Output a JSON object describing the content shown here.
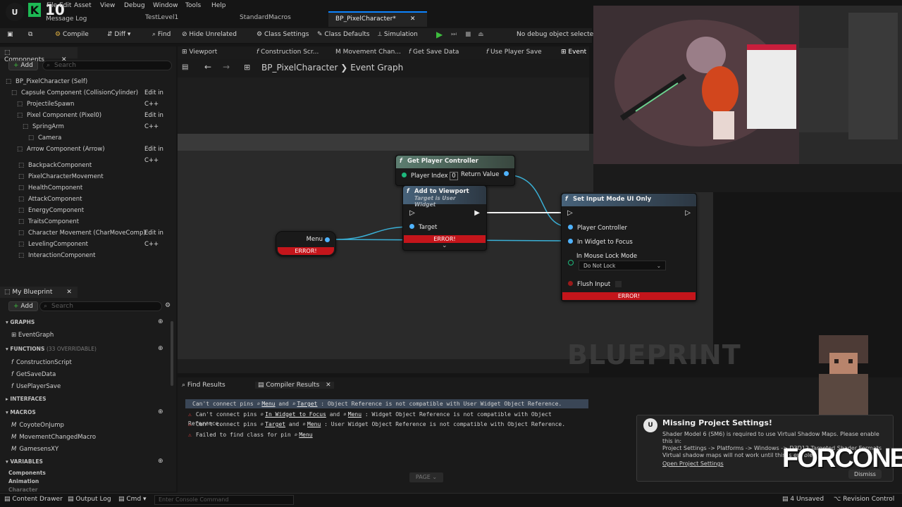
{
  "app": {
    "version_badge": "K",
    "version_num": "10",
    "message_log": "Message Log"
  },
  "menu": [
    "File",
    "Edit",
    "Asset",
    "View",
    "Debug",
    "Window",
    "Tools",
    "Help"
  ],
  "document_tabs": [
    {
      "label": "TestLevel1",
      "active": false
    },
    {
      "label": "StandardMacros",
      "active": false
    },
    {
      "label": "BP_PixelCharacter*",
      "active": true
    }
  ],
  "toolbar": {
    "compile": "Compile",
    "diff": "Diff",
    "find": "Find",
    "hide_unrelated": "Hide Unrelated",
    "class_settings": "Class Settings",
    "class_defaults": "Class Defaults",
    "simulation": "Simulation",
    "debug_object": "No debug object selected"
  },
  "components_panel": {
    "title": "Components",
    "add": "Add",
    "search_placeholder": "Search",
    "edit_in_cpp": "Edit in C++",
    "items": [
      {
        "label": "BP_PixelCharacter (Self)",
        "indent": 0,
        "cpp": false
      },
      {
        "label": "Capsule Component (CollisionCylinder)",
        "indent": 1,
        "cpp": true
      },
      {
        "label": "ProjectileSpawn",
        "indent": 2,
        "cpp": false
      },
      {
        "label": "Pixel Component (Pixel0)",
        "indent": 2,
        "cpp": true
      },
      {
        "label": "SpringArm",
        "indent": 3,
        "cpp": false
      },
      {
        "label": "Camera",
        "indent": 4,
        "cpp": false
      },
      {
        "label": "Arrow Component (Arrow)",
        "indent": 2,
        "cpp": true
      }
    ],
    "actor_components": [
      {
        "label": "BackpackComponent",
        "cpp": false
      },
      {
        "label": "PixelCharacterMovement",
        "cpp": false
      },
      {
        "label": "HealthComponent",
        "cpp": false
      },
      {
        "label": "AttackComponent",
        "cpp": false
      },
      {
        "label": "EnergyComponent",
        "cpp": false
      },
      {
        "label": "TraitsComponent",
        "cpp": false
      },
      {
        "label": "Character Movement (CharMoveComp)",
        "cpp": true
      },
      {
        "label": "LevelingComponent",
        "cpp": false
      },
      {
        "label": "InteractionComponent",
        "cpp": false
      }
    ]
  },
  "my_blueprint": {
    "title": "My Blueprint",
    "add": "Add",
    "search_placeholder": "Search",
    "graphs_label": "GRAPHS",
    "graphs": [
      "EventGraph"
    ],
    "functions_label": "FUNCTIONS",
    "functions_note": "(33 OVERRIDABLE)",
    "functions": [
      "ConstructionScript",
      "GetSaveData",
      "UsePlayerSave"
    ],
    "interfaces_label": "INTERFACES",
    "macros_label": "MACROS",
    "macros": [
      "CoyoteOnJump",
      "MovementChangedMacro",
      "GamesensXY"
    ],
    "variables_label": "VARIABLES",
    "variables": [
      "Components",
      "Animation",
      "Character"
    ]
  },
  "graph_tabs": [
    "Viewport",
    "Construction Scr...",
    "Movement Chan...",
    "Get Save Data",
    "Use Player Save",
    "Event"
  ],
  "breadcrumb": {
    "blueprint": "BP_PixelCharacter",
    "sep": "❯",
    "graph": "Event Graph"
  },
  "watermark": "BLUEPRINT",
  "nodes": {
    "menu_var": {
      "label": "Menu",
      "error": "ERROR!"
    },
    "get_player_controller": {
      "title": "Get Player Controller",
      "pin_index": "Player Index",
      "index_value": "0",
      "return": "Return Value"
    },
    "add_to_viewport": {
      "title": "Add to Viewport",
      "subtitle": "Target is User Widget",
      "target": "Target",
      "error": "ERROR!"
    },
    "set_input_mode": {
      "title": "Set Input Mode UI Only",
      "player_controller": "Player Controller",
      "widget_focus": "In Widget to Focus",
      "mouse_lock": "In Mouse Lock Mode",
      "mouse_lock_value": "Do Not Lock",
      "flush": "Flush Input",
      "error": "ERROR!"
    }
  },
  "bottom_tabs": {
    "find": "Find Results",
    "compiler": "Compiler Results"
  },
  "compiler_results": [
    {
      "icon": false,
      "parts": [
        "Can't connect pins ",
        "Menu",
        " and ",
        "Target",
        " : Object Reference is not compatible with User Widget Object Reference."
      ],
      "selected": true
    },
    {
      "icon": true,
      "parts": [
        "Can't connect pins ",
        "In Widget to Focus",
        " and ",
        "Menu",
        " : Widget Object Reference is not compatible with Object Reference."
      ],
      "selected": false
    },
    {
      "icon": true,
      "parts": [
        "Can't connect pins ",
        "Target",
        " and ",
        "Menu",
        " : User Widget Object Reference is not compatible with Object Reference."
      ],
      "selected": false
    },
    {
      "icon": true,
      "parts": [
        "Failed to find class for pin ",
        "Menu"
      ],
      "selected": false
    }
  ],
  "page_button": "PAGE",
  "status_bar": {
    "content_drawer": "Content Drawer",
    "output_log": "Output Log",
    "cmd": "Cmd",
    "console_placeholder": "Enter Console Command",
    "unsaved": "4 Unsaved",
    "revision": "Revision Control"
  },
  "toast": {
    "title": "Missing Project Settings!",
    "body_line1": "Shader Model 6 (SM6) is required to use Virtual Shadow Maps. Please enable this in:",
    "body_line2": "Project Settings -> Platforms -> Windows -> D3D12 Targeted Shader Formats",
    "body_line3": "Virtual shadow maps will not work until this is enabled.",
    "link": "Open Project Settings",
    "dismiss": "Dismiss"
  },
  "overlay_logo": "FORCONE",
  "colors": {
    "accent": "#0d84ff",
    "error": "#c4151b",
    "pin": "#4fb3ff",
    "node_green": "#5c7d70",
    "node_blue": "#47627a"
  }
}
